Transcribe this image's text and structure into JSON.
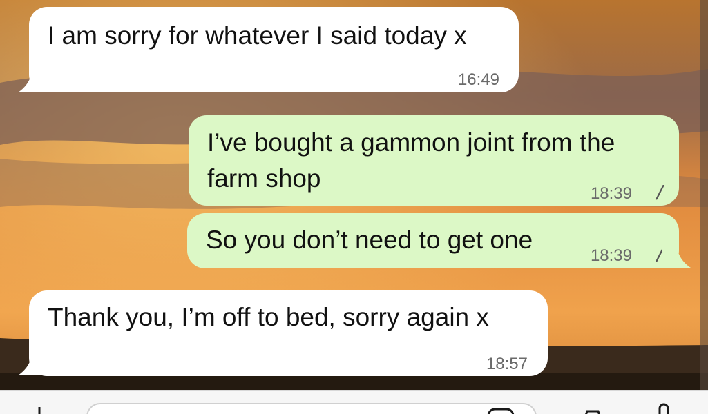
{
  "messages": [
    {
      "direction": "incoming",
      "text": "I am sorry for whatever I said today x",
      "time": "16:49"
    },
    {
      "direction": "outgoing",
      "text": "I’ve bought a gammon joint from the\nfarm shop",
      "time": "18:39",
      "status": "read"
    },
    {
      "direction": "outgoing",
      "text": "So you don’t need to get one",
      "time": "18:39",
      "status": "read"
    },
    {
      "direction": "incoming",
      "text": "Thank you, I’m off to bed, sorry again x",
      "time": "18:57"
    }
  ],
  "composer": {
    "left_icon": "plus-icon",
    "right_icons": [
      "sticker-icon",
      "camera-icon",
      "microphone-icon"
    ]
  },
  "colors": {
    "incoming_bubble": "#ffffff",
    "outgoing_bubble": "#dcf8c6",
    "read_ticks": "#555555",
    "wallpaper_sky": "#e8a04a"
  },
  "icons": {
    "read_ticks": "double-check-icon"
  }
}
